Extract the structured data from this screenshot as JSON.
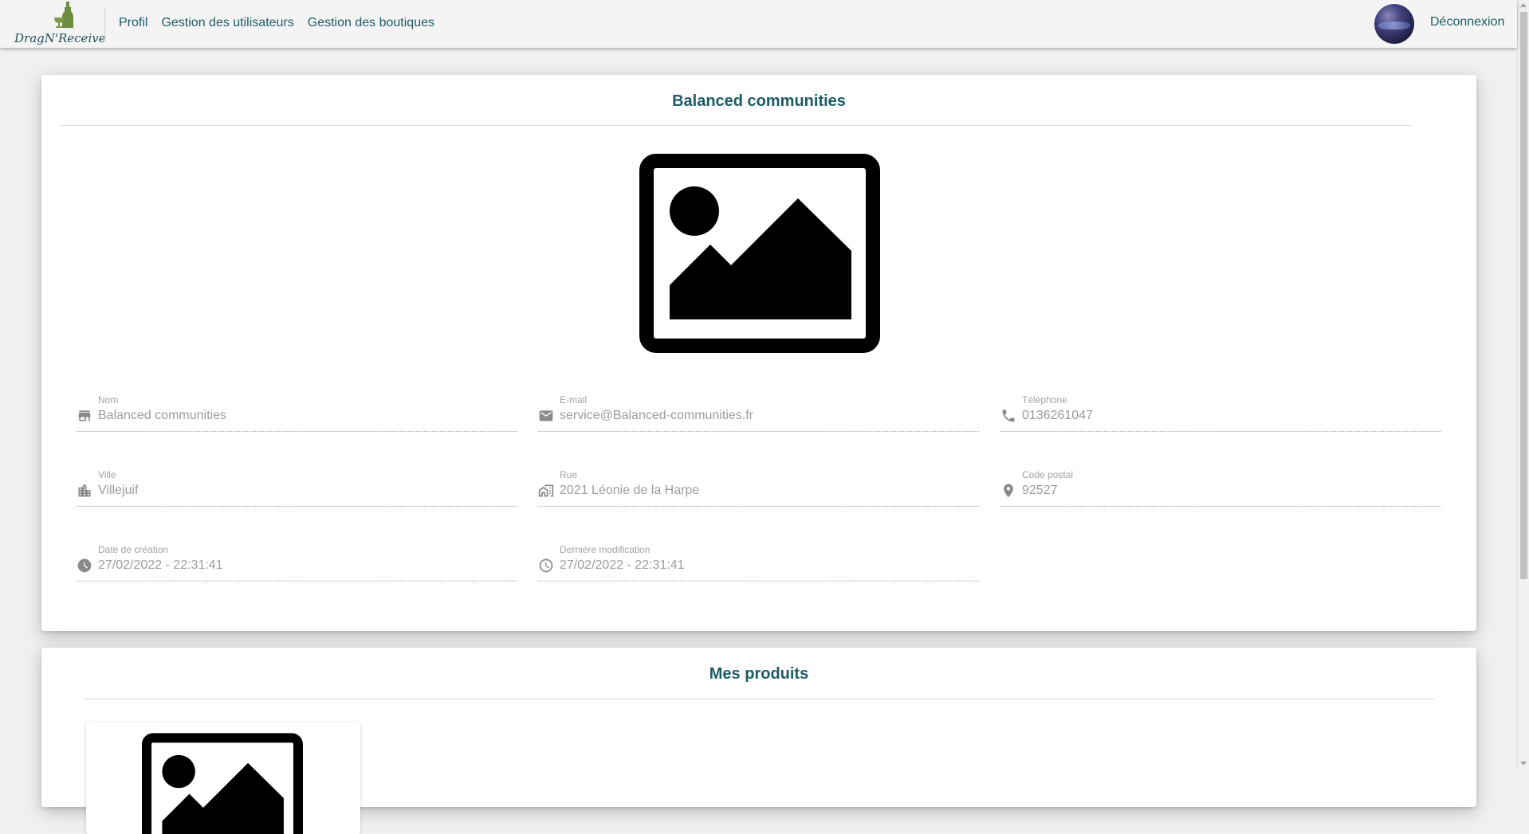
{
  "brand": {
    "logo_text": "DragN'Receive"
  },
  "nav": {
    "items": [
      "Profil",
      "Gestion des utilisateurs",
      "Gestion des boutiques"
    ]
  },
  "header": {
    "logout_label": "Déconnexion"
  },
  "shop": {
    "title": "Balanced communities",
    "image_icon": "image-placeholder-icon",
    "fields": {
      "name": {
        "label": "Nom",
        "value": "Balanced communities",
        "icon": "store-icon"
      },
      "email": {
        "label": "E-mail",
        "value": "service@Balanced-communities.fr",
        "icon": "mail-icon"
      },
      "phone": {
        "label": "Téléphone",
        "value": "0136261047",
        "icon": "phone-icon"
      },
      "city": {
        "label": "Ville",
        "value": "Villejuif",
        "icon": "city-icon"
      },
      "street": {
        "label": "Rue",
        "value": "2021 Léonie de la Harpe",
        "icon": "street-icon"
      },
      "postal": {
        "label": "Code postal",
        "value": "92527",
        "icon": "location-pin-icon"
      },
      "created": {
        "label": "Date de création",
        "value": "27/02/2022 - 22:31:41",
        "icon": "clock-filled-icon"
      },
      "modified": {
        "label": "Dernière modification",
        "value": "27/02/2022 - 22:31:41",
        "icon": "clock-outline-icon"
      }
    }
  },
  "products": {
    "title": "Mes produits",
    "image_icon": "image-placeholder-icon"
  },
  "colors": {
    "accent": "#1e5b66",
    "muted_text": "#9c9c9c",
    "background": "#f0f0f0"
  }
}
